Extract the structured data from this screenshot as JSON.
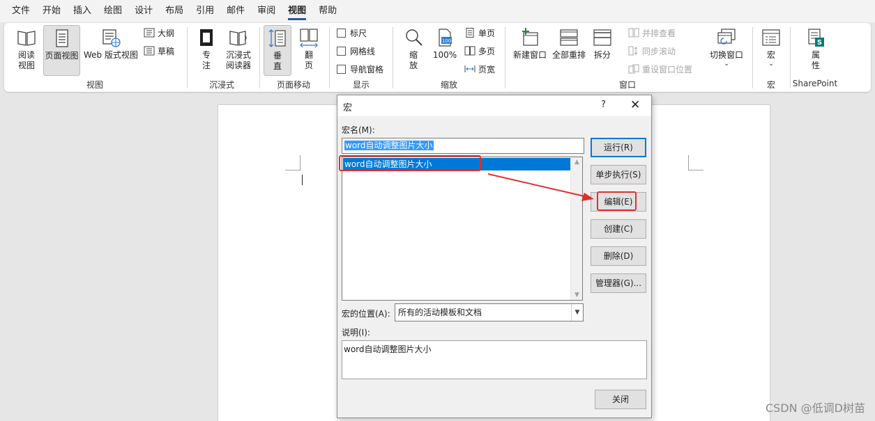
{
  "menu": [
    "文件",
    "开始",
    "插入",
    "绘图",
    "设计",
    "布局",
    "引用",
    "邮件",
    "审阅",
    "视图",
    "帮助"
  ],
  "menu_active": "视图",
  "ribbon": {
    "views": {
      "read_mode": [
        "阅读",
        "视图"
      ],
      "print_layout": "页面视图",
      "web_layout": "Web 版式视图",
      "outline": "大纲",
      "draft": "草稿",
      "group": "视图"
    },
    "immersive": {
      "focus": [
        "专",
        "注"
      ],
      "reader": [
        "沉浸式",
        "阅读器"
      ],
      "group": "沉浸式"
    },
    "page_movement": {
      "vertical": [
        "垂",
        "直"
      ],
      "side_to_side": [
        "翻",
        "页"
      ],
      "group": "页面移动"
    },
    "show": {
      "ruler": "标尺",
      "gridlines": "网格线",
      "nav_pane": "导航窗格",
      "group": "显示"
    },
    "zoom": {
      "zoom": [
        "缩",
        "放"
      ],
      "hundred": "100%",
      "one_page": "单页",
      "multi_page": "多页",
      "page_width": "页宽",
      "group": "缩放",
      "zoom_icon_text": "100"
    },
    "window": {
      "new_window": "新建窗口",
      "arrange_all": "全部重排",
      "split": "拆分",
      "side_by_side": "并排查看",
      "sync_scroll": "同步滚动",
      "reset_pos": "重设窗口位置",
      "switch": "切换窗口",
      "group": "窗口"
    },
    "macros": {
      "macros": "宏",
      "group": "宏"
    },
    "sharepoint": {
      "properties": [
        "属",
        "性"
      ],
      "group": "SharePoint"
    }
  },
  "dialog": {
    "title": "宏",
    "help": "?",
    "close": "✕",
    "macro_name_label": "宏名(M):",
    "macro_name_value": "word自动调整图片大小",
    "list_items": [
      "word自动调整图片大小"
    ],
    "buttons": {
      "run": "运行(R)",
      "step": "单步执行(S)",
      "edit": "编辑(E)",
      "create": "创建(C)",
      "delete": "删除(D)",
      "organizer": "管理器(G)...",
      "close": "关闭"
    },
    "macros_in_label": "宏的位置(A):",
    "macros_in_value": "所有的活动模板和文档",
    "description_label": "说明(I):",
    "description_value": "word自动调整图片大小"
  },
  "watermark": "CSDN @低调D树苗",
  "colors": {
    "accent": "#0078d7",
    "annotation": "#e0302b",
    "brand": "#2b579a"
  }
}
